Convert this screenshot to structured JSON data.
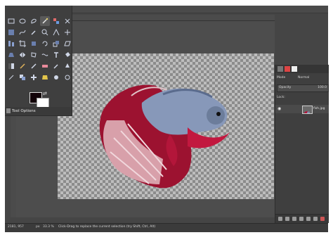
{
  "tool_options": {
    "label": "Tool Options"
  },
  "statusbar": {
    "coords": "2181, 957",
    "unit": "px",
    "zoom": "33.3 %",
    "hint": "Click-Drag to replace the current selection (try Shift, Ctrl, Alt)"
  },
  "dock": {
    "mode_label": "Mode",
    "mode_value": "Normal",
    "opacity_label": "Opacity",
    "opacity_value": "100.0",
    "lock_label": "Lock:",
    "layer_name": "fish.jpg"
  },
  "colors": {
    "foreground": "#120208",
    "background": "#ffffff",
    "fish_red": "#b0163a",
    "fish_blue": "#7f8fb0"
  },
  "icons": [
    "rect-select-icon",
    "ellipse-select-icon",
    "free-select-icon",
    "fuzzy-select-icon",
    "select-by-color-icon",
    "scissors-icon",
    "foreground-select-icon",
    "paths-icon",
    "color-picker-icon",
    "zoom-icon",
    "measure-icon",
    "move-icon",
    "align-icon",
    "crop-icon",
    "unified-transform-icon",
    "rotate-icon",
    "scale-icon",
    "shear-icon",
    "perspective-icon",
    "flip-icon",
    "cage-transform-icon",
    "warp-transform-icon",
    "text-icon",
    "bucket-fill-icon",
    "blend-icon",
    "pencil-icon",
    "paintbrush-icon",
    "eraser-icon",
    "airbrush-icon",
    "ink-icon",
    "mypaint-brush-icon",
    "clone-icon",
    "heal-icon",
    "perspective-clone-icon",
    "smudge-icon",
    "blur-icon",
    "dodge-burn-icon"
  ]
}
